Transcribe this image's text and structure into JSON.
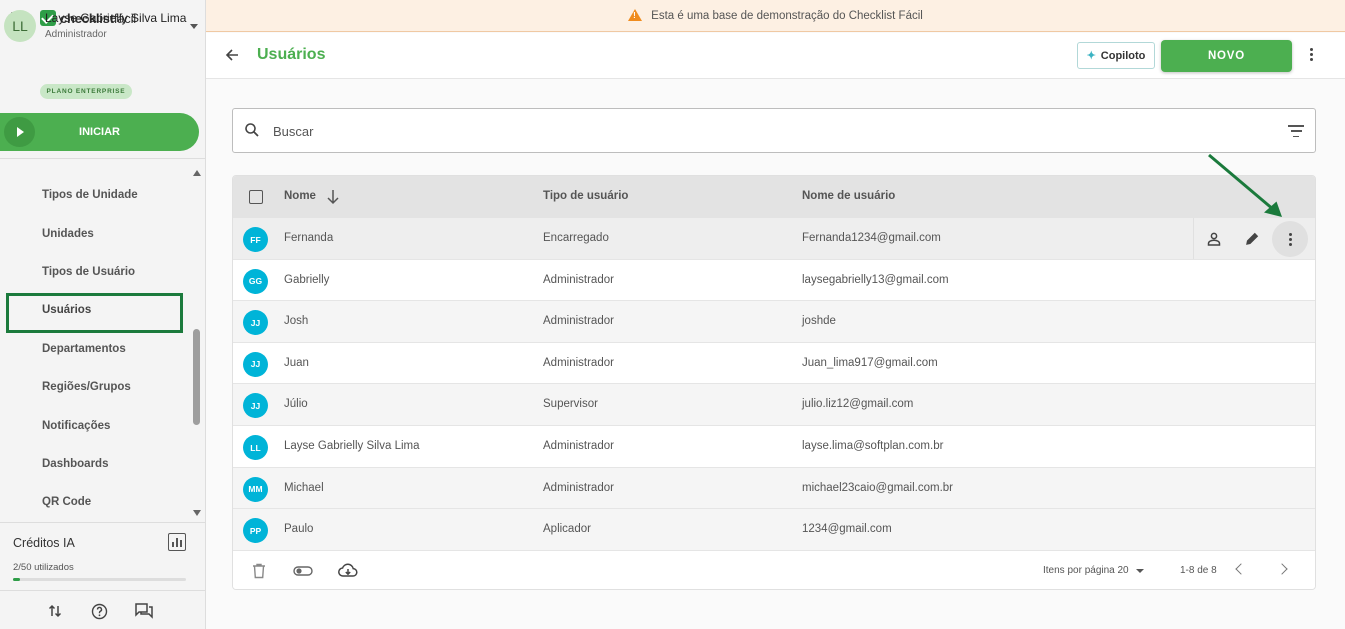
{
  "app": {
    "logo_bold": "checklist",
    "logo_light": "fácil"
  },
  "banner": {
    "text": "Esta é uma base de demonstração do Checklist Fácil"
  },
  "user": {
    "initials": "LL",
    "name": "Layse Gabrielly Silva Lima",
    "role": "Administrador",
    "plan": "PLANO ENTERPRISE"
  },
  "start_button": {
    "label": "INICIAR"
  },
  "nav": {
    "items": [
      {
        "label": "Tipos de Unidade"
      },
      {
        "label": "Unidades"
      },
      {
        "label": "Tipos de Usuário"
      },
      {
        "label": "Usuários"
      },
      {
        "label": "Departamentos"
      },
      {
        "label": "Regiões/Grupos"
      },
      {
        "label": "Notificações"
      },
      {
        "label": "Dashboards"
      },
      {
        "label": "QR Code"
      }
    ],
    "active": "Usuários"
  },
  "credits": {
    "title": "Créditos IA",
    "used_text": "2/50 utilizados",
    "used_fraction": 0.04
  },
  "header": {
    "title": "Usuários",
    "copilot_label": "Copiloto",
    "new_label": "NOVO"
  },
  "search": {
    "placeholder": "Buscar",
    "value": ""
  },
  "table": {
    "columns": {
      "name": "Nome",
      "type": "Tipo de usuário",
      "username": "Nome de usuário"
    },
    "rows": [
      {
        "initials": "FF",
        "name": "Fernanda",
        "type": "Encarregado",
        "username": "Fernanda1234@gmail.com"
      },
      {
        "initials": "GG",
        "name": "Gabrielly",
        "type": "Administrador",
        "username": "laysegabrielly13@gmail.com"
      },
      {
        "initials": "JJ",
        "name": "Josh",
        "type": "Administrador",
        "username": "joshde"
      },
      {
        "initials": "JJ",
        "name": "Juan",
        "type": "Administrador",
        "username": "Juan_lima917@gmail.com"
      },
      {
        "initials": "JJ",
        "name": "Júlio",
        "type": "Supervisor",
        "username": "julio.liz12@gmail.com"
      },
      {
        "initials": "LL",
        "name": "Layse Gabrielly Silva Lima",
        "type": "Administrador",
        "username": "layse.lima@softplan.com.br"
      },
      {
        "initials": "MM",
        "name": "Michael",
        "type": "Administrador",
        "username": "michael23caio@gmail.com.br"
      },
      {
        "initials": "PP",
        "name": "Paulo",
        "type": "Aplicador",
        "username": "1234@gmail.com"
      }
    ],
    "footer": {
      "per_page_label": "Itens por página",
      "per_page_value": "20",
      "range": "1-8 de 8"
    }
  },
  "colors": {
    "brand": "#4caf50",
    "avatar": "#00b4d8",
    "highlight": "#1b7a3c",
    "warning": "#f08c1e"
  }
}
